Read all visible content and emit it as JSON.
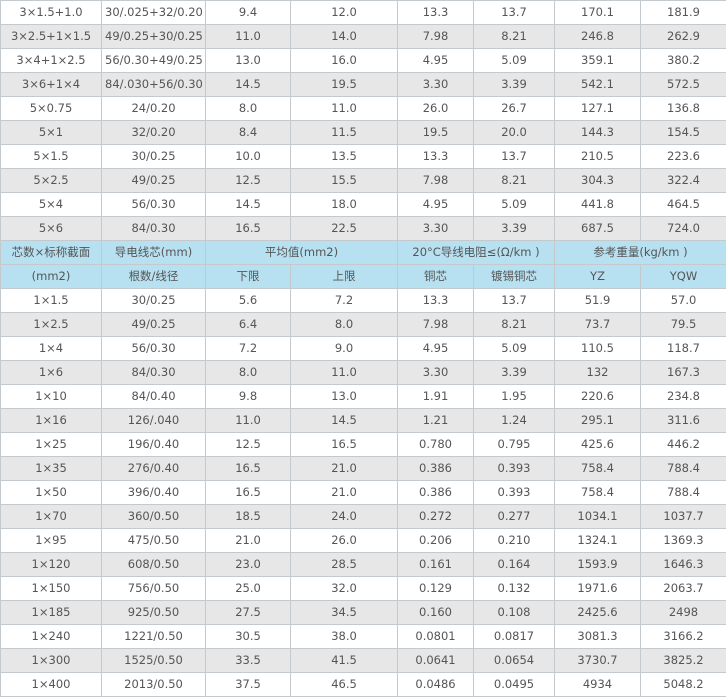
{
  "colors": {
    "header_bg": "#b7e1f1",
    "alt_row_bg": "#e7e7e7",
    "border": "#c3c9cc",
    "text": "#555555"
  },
  "top_rows": [
    [
      "3×1.5+1.0",
      "30/.025+32/0.20",
      "9.4",
      "12.0",
      "13.3",
      "13.7",
      "170.1",
      "181.9"
    ],
    [
      "3×2.5+1×1.5",
      "49/0.25+30/0.25",
      "11.0",
      "14.0",
      "7.98",
      "8.21",
      "246.8",
      "262.9"
    ],
    [
      "3×4+1×2.5",
      "56/0.30+49/0.25",
      "13.0",
      "16.0",
      "4.95",
      "5.09",
      "359.1",
      "380.2"
    ],
    [
      "3×6+1×4",
      "84/.030+56/0.30",
      "14.5",
      "19.5",
      "3.30",
      "3.39",
      "542.1",
      "572.5"
    ],
    [
      "5×0.75",
      "24/0.20",
      "8.0",
      "11.0",
      "26.0",
      "26.7",
      "127.1",
      "136.8"
    ],
    [
      "5×1",
      "32/0.20",
      "8.4",
      "11.5",
      "19.5",
      "20.0",
      "144.3",
      "154.5"
    ],
    [
      "5×1.5",
      "30/0.25",
      "10.0",
      "13.5",
      "13.3",
      "13.7",
      "210.5",
      "223.6"
    ],
    [
      "5×2.5",
      "49/0.25",
      "12.5",
      "15.5",
      "7.98",
      "8.21",
      "304.3",
      "322.4"
    ],
    [
      "5×4",
      "56/0.30",
      "14.5",
      "18.0",
      "4.95",
      "5.09",
      "441.8",
      "464.5"
    ],
    [
      "5×6",
      "84/0.30",
      "16.5",
      "22.5",
      "3.30",
      "3.39",
      "687.5",
      "724.0"
    ]
  ],
  "header": {
    "core_label": "芯数×标称截面",
    "core_unit": "(mm2)",
    "conductor_label": "导电线芯(mm)",
    "conductor_sub": "根数/线径",
    "avg_label": "平均值(mm2)",
    "lower": "下限",
    "upper": "上限",
    "resistance_label": "20°C导线电阻≤(Ω/km )",
    "copper": "铜芯",
    "tinned_copper": "镀锡铜芯",
    "weight_label": "参考重量(kg/km )",
    "yz": "YZ",
    "yqw": "YQW"
  },
  "bottom_rows": [
    [
      "1×1.5",
      "30/0.25",
      "5.6",
      "7.2",
      "13.3",
      "13.7",
      "51.9",
      "57.0"
    ],
    [
      "1×2.5",
      "49/0.25",
      "6.4",
      "8.0",
      "7.98",
      "8.21",
      "73.7",
      "79.5"
    ],
    [
      "1×4",
      "56/0.30",
      "7.2",
      "9.0",
      "4.95",
      "5.09",
      "110.5",
      "118.7"
    ],
    [
      "1×6",
      "84/0.30",
      "8.0",
      "11.0",
      "3.30",
      "3.39",
      "132",
      "167.3"
    ],
    [
      "1×10",
      "84/0.40",
      "9.8",
      "13.0",
      "1.91",
      "1.95",
      "220.6",
      "234.8"
    ],
    [
      "1×16",
      "126/.040",
      "11.0",
      "14.5",
      "1.21",
      "1.24",
      "295.1",
      "311.6"
    ],
    [
      "1×25",
      "196/0.40",
      "12.5",
      "16.5",
      "0.780",
      "0.795",
      "425.6",
      "446.2"
    ],
    [
      "1×35",
      "276/0.40",
      "16.5",
      "21.0",
      "0.386",
      "0.393",
      "758.4",
      "788.4"
    ],
    [
      "1×50",
      "396/0.40",
      "16.5",
      "21.0",
      "0.386",
      "0.393",
      "758.4",
      "788.4"
    ],
    [
      "1×70",
      "360/0.50",
      "18.5",
      "24.0",
      "0.272",
      "0.277",
      "1034.1",
      "1037.7"
    ],
    [
      "1×95",
      "475/0.50",
      "21.0",
      "26.0",
      "0.206",
      "0.210",
      "1324.1",
      "1369.3"
    ],
    [
      "1×120",
      "608/0.50",
      "23.0",
      "28.5",
      "0.161",
      "0.164",
      "1593.9",
      "1646.3"
    ],
    [
      "1×150",
      "756/0.50",
      "25.0",
      "32.0",
      "0.129",
      "0.132",
      "1971.6",
      "2063.7"
    ],
    [
      "1×185",
      "925/0.50",
      "27.5",
      "34.5",
      "0.160",
      "0.108",
      "2425.6",
      "2498"
    ],
    [
      "1×240",
      "1221/0.50",
      "30.5",
      "38.0",
      "0.0801",
      "0.0817",
      "3081.3",
      "3166.2"
    ],
    [
      "1×300",
      "1525/0.50",
      "33.5",
      "41.5",
      "0.0641",
      "0.0654",
      "3730.7",
      "3825.2"
    ],
    [
      "1×400",
      "2013/0.50",
      "37.5",
      "46.5",
      "0.0486",
      "0.0495",
      "4934",
      "5048.2"
    ]
  ]
}
